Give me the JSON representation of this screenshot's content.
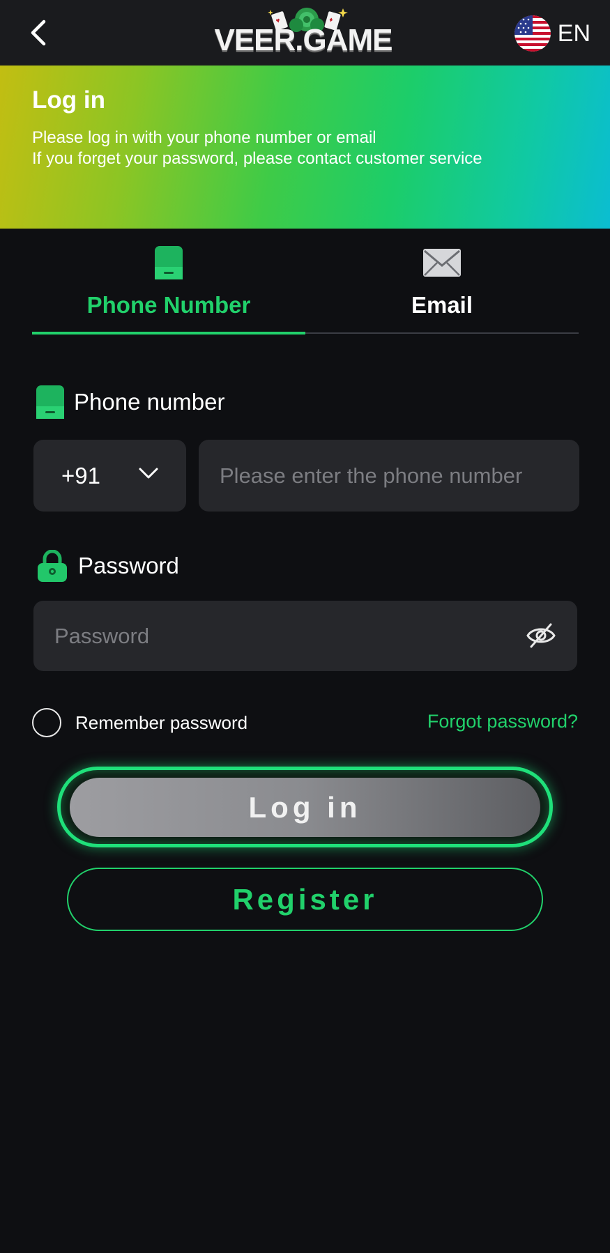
{
  "header": {
    "logo_text": "VEER.GAME",
    "language_code": "EN",
    "language_flag": "us-flag-icon"
  },
  "banner": {
    "title": "Log in",
    "line1": "Please log in with your phone number or email",
    "line2": "If you forget your password, please contact customer service"
  },
  "tabs": [
    {
      "label": "Phone Number",
      "icon": "phone-icon",
      "active": true
    },
    {
      "label": "Email",
      "icon": "mail-icon",
      "active": false
    }
  ],
  "form": {
    "phone_label": "Phone number",
    "country_code": "+91",
    "phone_placeholder": "Please enter the phone number",
    "password_label": "Password",
    "password_placeholder": "Password",
    "remember_label": "Remember password",
    "remember_checked": false,
    "forgot_label": "Forgot password?"
  },
  "buttons": {
    "login_label": "Log in",
    "register_label": "Register"
  },
  "colors": {
    "accent": "#21d16b",
    "background": "#0e0f12",
    "header": "#1a1b1e",
    "input": "#26272b"
  }
}
